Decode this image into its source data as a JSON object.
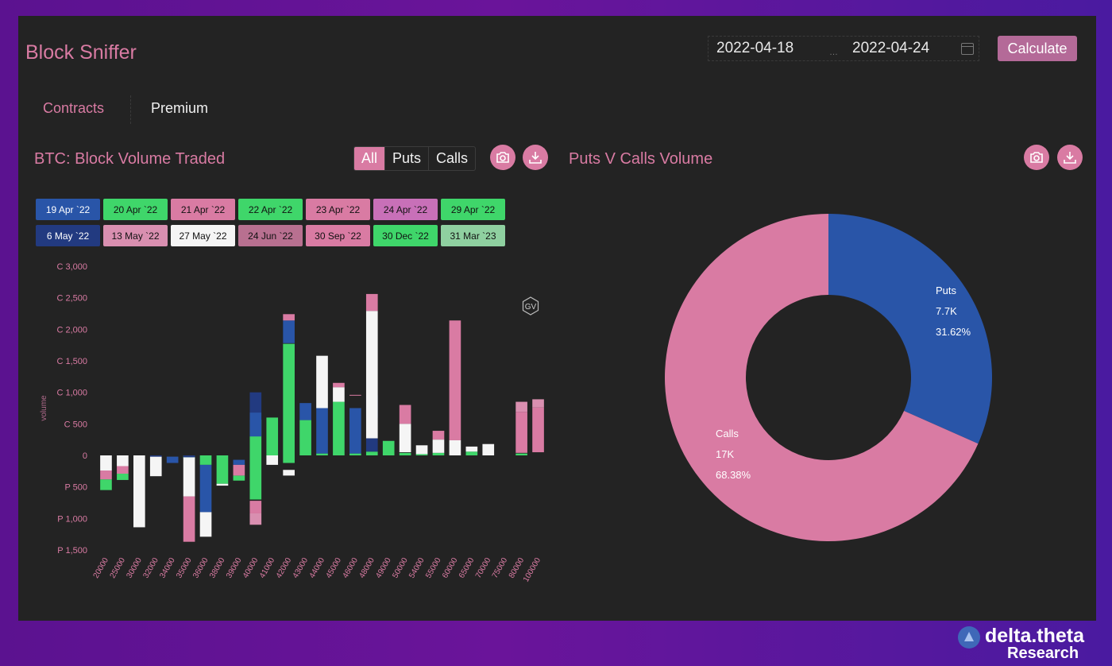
{
  "app": {
    "title": "Block Sniffer",
    "date_from": "2022-04-18",
    "date_to": "2022-04-24",
    "calculate_label": "Calculate"
  },
  "tabs": [
    {
      "label": "Contracts",
      "active": true
    },
    {
      "label": "Premium",
      "active": false
    }
  ],
  "colors": {
    "accent": "#d97ba3",
    "puts": "#2955a8",
    "calls": "#d97ba3",
    "background": "#232323"
  },
  "left_panel": {
    "title": "BTC: Block Volume Traded",
    "filters": [
      "All",
      "Puts",
      "Calls"
    ],
    "active_filter": "All",
    "icons": [
      "camera-icon",
      "download-icon"
    ],
    "watermark": "GV"
  },
  "right_panel": {
    "title": "Puts V Calls Volume",
    "icons": [
      "camera-icon",
      "download-icon"
    ]
  },
  "legend": [
    {
      "label": "19 Apr `22",
      "color": "#2955a8"
    },
    {
      "label": "20 Apr `22",
      "color": "#3fd66a"
    },
    {
      "label": "21 Apr `22",
      "color": "#d97ba3"
    },
    {
      "label": "22 Apr `22",
      "color": "#3fd66a"
    },
    {
      "label": "23 Apr `22",
      "color": "#d97ba3"
    },
    {
      "label": "24 Apr `22",
      "color": "#c870b8"
    },
    {
      "label": "29 Apr `22",
      "color": "#3fd66a"
    },
    {
      "label": "6 May `22",
      "color": "#223a80"
    },
    {
      "label": "13 May `22",
      "color": "#d98fb0"
    },
    {
      "label": "27 May `22",
      "color": "#f5f5f5"
    },
    {
      "label": "24 Jun `22",
      "color": "#b87090"
    },
    {
      "label": "30 Sep `22",
      "color": "#d97ba3"
    },
    {
      "label": "30 Dec `22",
      "color": "#3fd66a"
    },
    {
      "label": "31 Mar `23",
      "color": "#8fd0a0"
    }
  ],
  "chart_data": [
    {
      "type": "bar",
      "stacked": true,
      "ylabel": "volume",
      "ylim": [
        -1500,
        3000
      ],
      "yticks": [
        {
          "value": 3000,
          "label": "C 3,000"
        },
        {
          "value": 2500,
          "label": "C 2,500"
        },
        {
          "value": 2000,
          "label": "C 2,000"
        },
        {
          "value": 1500,
          "label": "C 1,500"
        },
        {
          "value": 1000,
          "label": "C 1,000"
        },
        {
          "value": 500,
          "label": "C 500"
        },
        {
          "value": 0,
          "label": "0"
        },
        {
          "value": -500,
          "label": "P 500"
        },
        {
          "value": -1000,
          "label": "P 1,000"
        },
        {
          "value": -1500,
          "label": "P 1,500"
        }
      ],
      "categories": [
        "20000",
        "25000",
        "30000",
        "32000",
        "34000",
        "35000",
        "36000",
        "38000",
        "39000",
        "40000",
        "41000",
        "42000",
        "43000",
        "44000",
        "45000",
        "46000",
        "48000",
        "49000",
        "50000",
        "54000",
        "55000",
        "60000",
        "65000",
        "70000",
        "75000",
        "80000",
        "100000"
      ],
      "series": [
        {
          "color": "#3fd66a",
          "values": [
            [
              -550,
              -380
            ],
            [
              -390,
              -290
            ],
            [
              0,
              0
            ],
            [
              0,
              0
            ],
            [
              0,
              0
            ],
            [
              -50,
              0
            ],
            [
              -150,
              0
            ],
            [
              -450,
              0
            ],
            [
              -400,
              -320
            ],
            [
              -700,
              570
            ],
            [
              0,
              600
            ],
            [
              -120,
              1770
            ],
            [
              0,
              560
            ],
            [
              0,
              30
            ],
            [
              0,
              850
            ],
            [
              0,
              30
            ],
            [
              0,
              60
            ],
            [
              0,
              230
            ],
            [
              0,
              40
            ],
            [
              0,
              20
            ],
            [
              0,
              40
            ],
            [
              0,
              0
            ],
            [
              0,
              60
            ],
            [
              0,
              0
            ],
            [
              0,
              0
            ],
            [
              0,
              30
            ],
            [
              0,
              0
            ]
          ]
        },
        {
          "color": "#2955a8",
          "values": [
            [
              0,
              0
            ],
            [
              0,
              0
            ],
            [
              0,
              0
            ],
            [
              0,
              0
            ],
            [
              -120,
              -20
            ],
            [
              0,
              0
            ],
            [
              -900,
              -150
            ],
            [
              0,
              0
            ],
            [
              -150,
              -70
            ],
            [
              300,
              680
            ],
            [
              0,
              0
            ],
            [
              1780,
              2140
            ],
            [
              560,
              830
            ],
            [
              30,
              750
            ],
            [
              0,
              0
            ],
            [
              30,
              750
            ],
            [
              600,
              950
            ],
            [
              0,
              0
            ],
            [
              0,
              0
            ],
            [
              0,
              0
            ],
            [
              0,
              0
            ],
            [
              0,
              0
            ],
            [
              0,
              0
            ],
            [
              0,
              0
            ],
            [
              0,
              0
            ],
            [
              0,
              0
            ],
            [
              0,
              0
            ]
          ]
        },
        {
          "color": "#d97ba3",
          "values": [
            [
              -380,
              -240
            ],
            [
              -290,
              -170
            ],
            [
              0,
              0
            ],
            [
              0,
              0
            ],
            [
              0,
              0
            ],
            [
              -1370,
              -650
            ],
            [
              0,
              0
            ],
            [
              0,
              0
            ],
            [
              -320,
              -150
            ],
            [
              -920,
              -720
            ],
            [
              0,
              0
            ],
            [
              2140,
              2240
            ],
            [
              0,
              0
            ],
            [
              0,
              0
            ],
            [
              1080,
              1150
            ],
            [
              950,
              960
            ],
            [
              2290,
              2560
            ],
            [
              0,
              0
            ],
            [
              500,
              800
            ],
            [
              0,
              0
            ],
            [
              250,
              390
            ],
            [
              240,
              2140
            ],
            [
              0,
              0
            ],
            [
              0,
              0
            ],
            [
              0,
              0
            ],
            [
              40,
              690
            ],
            [
              50,
              760
            ]
          ]
        },
        {
          "color": "#f5f5f5",
          "values": [
            [
              -240,
              0
            ],
            [
              -170,
              0
            ],
            [
              -1140,
              0
            ],
            [
              -330,
              -20
            ],
            [
              0,
              0
            ],
            [
              -650,
              -30
            ],
            [
              -1290,
              -900
            ],
            [
              -480,
              -450
            ],
            [
              0,
              0
            ],
            [
              0,
              0
            ],
            [
              -150,
              0
            ],
            [
              -320,
              -230
            ],
            [
              0,
              0
            ],
            [
              750,
              1580
            ],
            [
              850,
              1080
            ],
            [
              0,
              0
            ],
            [
              270,
              2290
            ],
            [
              0,
              0
            ],
            [
              50,
              500
            ],
            [
              20,
              160
            ],
            [
              40,
              250
            ],
            [
              0,
              240
            ],
            [
              60,
              140
            ],
            [
              0,
              180
            ],
            [
              0,
              0
            ],
            [
              0,
              0
            ],
            [
              0,
              0
            ]
          ]
        },
        {
          "color": "#223a80",
          "values": [
            [
              0,
              0
            ],
            [
              0,
              0
            ],
            [
              0,
              0
            ],
            [
              -20,
              0
            ],
            [
              0,
              0
            ],
            [
              0,
              -30
            ],
            [
              0,
              0
            ],
            [
              0,
              0
            ],
            [
              0,
              0
            ],
            [
              680,
              1000
            ],
            [
              0,
              0
            ],
            [
              0,
              0
            ],
            [
              0,
              0
            ],
            [
              0,
              0
            ],
            [
              0,
              0
            ],
            [
              0,
              0
            ],
            [
              60,
              270
            ],
            [
              0,
              0
            ],
            [
              0,
              0
            ],
            [
              0,
              0
            ],
            [
              0,
              0
            ],
            [
              0,
              0
            ],
            [
              0,
              0
            ],
            [
              0,
              0
            ],
            [
              0,
              0
            ],
            [
              0,
              0
            ],
            [
              0,
              0
            ]
          ]
        },
        {
          "color": "#d98fb0",
          "values": [
            [
              0,
              0
            ],
            [
              0,
              0
            ],
            [
              0,
              0
            ],
            [
              0,
              0
            ],
            [
              0,
              0
            ],
            [
              0,
              0
            ],
            [
              0,
              0
            ],
            [
              0,
              0
            ],
            [
              0,
              0
            ],
            [
              -1100,
              -920
            ],
            [
              0,
              0
            ],
            [
              0,
              0
            ],
            [
              0,
              0
            ],
            [
              0,
              0
            ],
            [
              0,
              0
            ],
            [
              0,
              0
            ],
            [
              0,
              0
            ],
            [
              0,
              0
            ],
            [
              0,
              0
            ],
            [
              0,
              0
            ],
            [
              0,
              0
            ],
            [
              0,
              0
            ],
            [
              0,
              0
            ],
            [
              0,
              0
            ],
            [
              0,
              0
            ],
            [
              690,
              850
            ],
            [
              760,
              890
            ]
          ]
        }
      ]
    },
    {
      "type": "pie",
      "donut": true,
      "slices": [
        {
          "name": "Puts",
          "value_label": "7.7K",
          "value": 7700,
          "percent": 31.62,
          "percent_label": "31.62%",
          "color": "#2955a8"
        },
        {
          "name": "Calls",
          "value_label": "17K",
          "value": 17000,
          "percent": 68.38,
          "percent_label": "68.38%",
          "color": "#d97ba3"
        }
      ]
    }
  ],
  "brand": {
    "line1": "delta.theta",
    "line2": "Research"
  }
}
